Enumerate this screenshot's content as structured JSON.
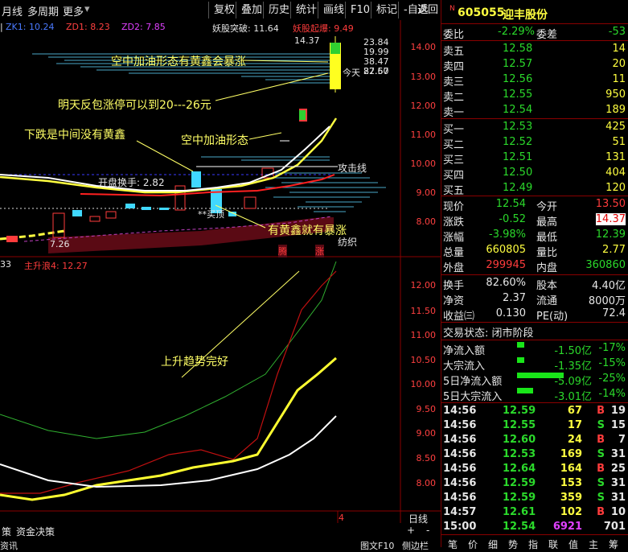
{
  "toolbar": {
    "menu_left": [
      "月线",
      "多周期",
      "更多"
    ],
    "buttons": [
      "复权",
      "叠加",
      "历史",
      "统计",
      "画线",
      "F10",
      "标记",
      "-自选",
      "返回"
    ]
  },
  "indicators": {
    "zk1": "ZK1: 10.24",
    "zd1": "ZD1: 8.23",
    "zd2": "ZD2: 7.85",
    "yaogu_tupo": "妖股突破: 11.64",
    "yaogu_qibao": "妖股起爆: 9.49",
    "lower_prefix": "33",
    "zhushenglang": "主升浪4: 12.27"
  },
  "price_axis_upper": [
    "14.00",
    "13.00",
    "12.00",
    "11.00",
    "10.00",
    "9.00",
    "8.00"
  ],
  "price_axis_lower": [
    "12.00",
    "11.50",
    "11.00",
    "10.50",
    "10.00",
    "9.50",
    "9.00",
    "8.50",
    "8.00"
  ],
  "chart_labels": {
    "high_marker": "14.37",
    "levels": [
      "23.84",
      "19.99",
      "38.47",
      "27.57",
      "82.60"
    ],
    "jintian": "今天",
    "low_marker": "7.26",
    "kaipan": "开盘换手: 2.82",
    "gongji": "攻击线",
    "fangzhi": "纺织",
    "teng": "腾",
    "zhang": "涨",
    "dingdi": "**买顶"
  },
  "annotations": {
    "a1": "空中加油形态有黄鑫会暴涨",
    "a2": "明天反包涨停可以到20---26元",
    "a3": "下跌是中间没有黄鑫",
    "a4": "空中加油形态",
    "a5": "有黄鑫就有暴涨",
    "a6": "上升趋势完好"
  },
  "bottom_bar": {
    "tabs": [
      "策",
      "资金决策"
    ],
    "period": "日线",
    "mark": "4",
    "controls": [
      "+",
      "-"
    ],
    "footer": [
      "资讯",
      "图文F10",
      "侧边栏"
    ]
  },
  "quote": {
    "code": "605055",
    "name": "迎丰股份",
    "weibi_label": "委比",
    "weibi": "-2.29%",
    "weicha_label": "委差",
    "weicha": "-53",
    "asks": [
      {
        "label": "卖五",
        "price": "12.58",
        "vol": "14"
      },
      {
        "label": "卖四",
        "price": "12.57",
        "vol": "20"
      },
      {
        "label": "卖三",
        "price": "12.56",
        "vol": "11"
      },
      {
        "label": "卖二",
        "price": "12.55",
        "vol": "950"
      },
      {
        "label": "卖一",
        "price": "12.54",
        "vol": "189"
      }
    ],
    "bids": [
      {
        "label": "买一",
        "price": "12.53",
        "vol": "425"
      },
      {
        "label": "买二",
        "price": "12.52",
        "vol": "51"
      },
      {
        "label": "买三",
        "price": "12.51",
        "vol": "131"
      },
      {
        "label": "买四",
        "price": "12.50",
        "vol": "404"
      },
      {
        "label": "买五",
        "price": "12.49",
        "vol": "120"
      }
    ],
    "stats": [
      {
        "l1": "现价",
        "v1": "12.54",
        "l2": "今开",
        "v2": "13.50"
      },
      {
        "l1": "涨跌",
        "v1": "-0.52",
        "l2": "最高",
        "v2": "14.37"
      },
      {
        "l1": "涨幅",
        "v1": "-3.98%",
        "l2": "最低",
        "v2": "12.39"
      },
      {
        "l1": "总量",
        "v1": "660805",
        "l2": "量比",
        "v2": "2.77"
      },
      {
        "l1": "外盘",
        "v1": "299945",
        "l2": "内盘",
        "v2": "360860"
      }
    ],
    "stats2": [
      {
        "l1": "换手",
        "v1": "82.60%",
        "l2": "股本",
        "v2": "4.40亿"
      },
      {
        "l1": "净资",
        "v1": "2.37",
        "l2": "流通",
        "v2": "8000万"
      },
      {
        "l1": "收益㈢",
        "v1": "0.130",
        "l2": "PE(动)",
        "v2": "72.4"
      }
    ],
    "trade_status": "交易状态: 闭市阶段",
    "flows": [
      {
        "label": "净流入额",
        "value": "-1.50亿",
        "pct": "-17%",
        "bar": 0.15
      },
      {
        "label": "大宗流入",
        "value": "-1.35亿",
        "pct": "-15%",
        "bar": 0.15
      },
      {
        "label": "5日净流入额",
        "value": "-5.09亿",
        "pct": "-25%",
        "bar": 1.0
      },
      {
        "label": "5日大宗流入",
        "value": "-3.01亿",
        "pct": "-14%",
        "bar": 0.35
      }
    ],
    "ticks": [
      {
        "time": "14:56",
        "price": "12.59",
        "vol": "67",
        "bs": "B",
        "n": "19"
      },
      {
        "time": "14:56",
        "price": "12.55",
        "vol": "17",
        "bs": "S",
        "n": "15"
      },
      {
        "time": "14:56",
        "price": "12.60",
        "vol": "24",
        "bs": "B",
        "n": "7"
      },
      {
        "time": "14:56",
        "price": "12.53",
        "vol": "169",
        "bs": "S",
        "n": "31"
      },
      {
        "time": "14:56",
        "price": "12.64",
        "vol": "164",
        "bs": "B",
        "n": "25"
      },
      {
        "time": "14:56",
        "price": "12.59",
        "vol": "153",
        "bs": "S",
        "n": "31"
      },
      {
        "time": "14:56",
        "price": "12.59",
        "vol": "359",
        "bs": "S",
        "n": "31"
      },
      {
        "time": "14:57",
        "price": "12.61",
        "vol": "102",
        "bs": "B",
        "n": "10"
      },
      {
        "time": "15:00",
        "price": "12.54",
        "vol": "6921",
        "bs": "",
        "n": "701"
      }
    ],
    "bottom_tabs": [
      "笔",
      "价",
      "细",
      "势",
      "指",
      "联",
      "值",
      "主",
      "筹"
    ]
  }
}
